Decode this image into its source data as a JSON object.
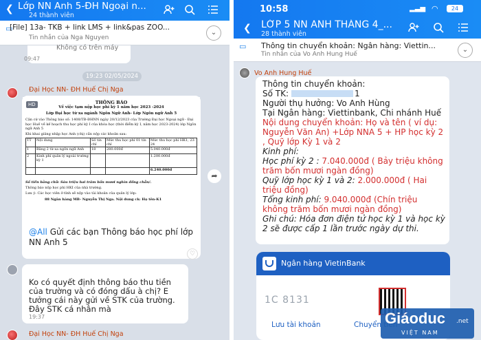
{
  "left": {
    "header": {
      "title": "Lớp NN Anh 5-ĐH Ngoại n...",
      "subtitle": "24 thành viên"
    },
    "pinned": {
      "title": "[File] 13a- TKB + link LMS + link&pas ZOO...",
      "sender": "Tin nhắn của Nga Nguyen"
    },
    "prev_text": "Không có trên máy",
    "prev_time": "09:47",
    "date_pill": "19:23 02/05/2024",
    "msg1": {
      "sender": "Đại Học NN- ĐH Huế Chị Nga",
      "badge": "HD",
      "doc": {
        "heading": "THÔNG BÁO",
        "line1": "Về việc tạm nộp học phí kỳ 1 năm học 2023 -2024",
        "line2": "Lớp Đại học từ xa ngành Ngôn Ngữ Anh- Lớp Ngôn ngữ Anh 5",
        "p1": "Căn cứ vào Thông báo số: 1408/TB-ĐHNN ngày 20/12/2023 của Trường Đại học Ngoại ngữ - Đại học Huế về kế hoạch thu học phí kỳ I của khóa học (thời điểm kỳ I, năm học 2023-2024) lớp Ngôn ngữ Anh 5",
        "p2": "Khi khai giảng nhập học Anh (chị) cần nộp các khoản sau:",
        "table_header": [
          "TT",
          "Nội dung",
          "Số tín chỉ",
          "Mức thu học phí 01 tín chỉ",
          "Mức thu học phí HK1, 23-24"
        ],
        "rows": [
          [
            "1",
            "Bằng 2 từ xa ngôn ngữ Anh",
            "18",
            "280.000đ",
            "5.040.000đ"
          ],
          [
            "2",
            "Kinh phí quản lý ngoài trường kỳ 1",
            "",
            "",
            "1.200.000đ"
          ],
          [
            "",
            "",
            "",
            "",
            "6.240.000đ"
          ]
        ],
        "words": "Số tiền bằng chữ: Sáu triệu hai trăm bốn mươi nghìn đồng chẵn/.",
        "note1": "Thông báo nộp học phí HKI của nhà trường.",
        "note2": "Lưu ý: Các học viên ở tỉnh sẽ nộp vào tài khoản của quản lý lớp:",
        "note3": "88 Ngân hàng MB- Nguyễn Thị Nga. Nội dung ck: Họ tên-K1"
      },
      "caption_tag": "@All",
      "caption": "Gửi các bạn Thông báo học phí lớp NN Anh 5"
    },
    "msg2": {
      "text": "Ko có quyết định thông báo thu tiền của trường và có đóng dấu à chị? E tưởng cái này gửi về STK của trường. Đây STK cá nhân mà",
      "time": "19:37"
    },
    "msg3_sender": "Đại Học NN- ĐH Huế Chị Nga"
  },
  "right": {
    "status": {
      "time": "10:58",
      "battery": "24"
    },
    "header": {
      "title": "LỚP 5 NN ANH THÁNG 4_...",
      "subtitle": "28 thành viên"
    },
    "pinned": {
      "title": "Thông tin chuyển khoản: Ngân hàng: Viettin...",
      "sender": "Tin nhắn của Vo Anh Hung Huế"
    },
    "sender": "Vo Anh Hung Huế",
    "lines": {
      "l1": "Thông tin chuyển khoản:",
      "l2": "Số TK:",
      "l2v": "1",
      "l3": "Người thụ hưởng: Vo Anh Hùng",
      "l4": "Tại Ngân hàng: Viettinbank, Chi nhánh Huế",
      "l5": "Nội dung chuyển khoản: Họ và tên ( ví dụ: Nguyễn Văn An) +Lớp NNA 5 + HP học kỳ 2 , Quỹ lớp Kỳ 1 và 2",
      "l6": "Kinh phí:",
      "l7a": "Học phí kỳ 2 :",
      "l7b": "7.040.000đ ( Bảy triệu không trăm bốn mươi ngàn đồng)",
      "l8a": "Quỹ lớp học kỳ 1 và 2:",
      "l8b": "2.000.000đ ( Hai triệu đồng)",
      "l9a": "Tổng kinh phí:",
      "l9b": "9.040.000đ (Chín triệu không trăm bốn mươi ngàn đồng)",
      "l10": "Ghi chú: Hóa đơn điện tử học kỳ 1 và học kỳ 2 sẽ được cấp 1 lần trước ngày dự thi."
    },
    "bank": {
      "name": "Ngân hàng VietinBank",
      "account": "1C          8131",
      "save": "Lưu tài khoản",
      "transfer": "Chuyển tiền"
    },
    "watermark": {
      "main": "Giáoduc",
      "sub": "VIỆT NAM",
      "tld": ".net"
    }
  }
}
